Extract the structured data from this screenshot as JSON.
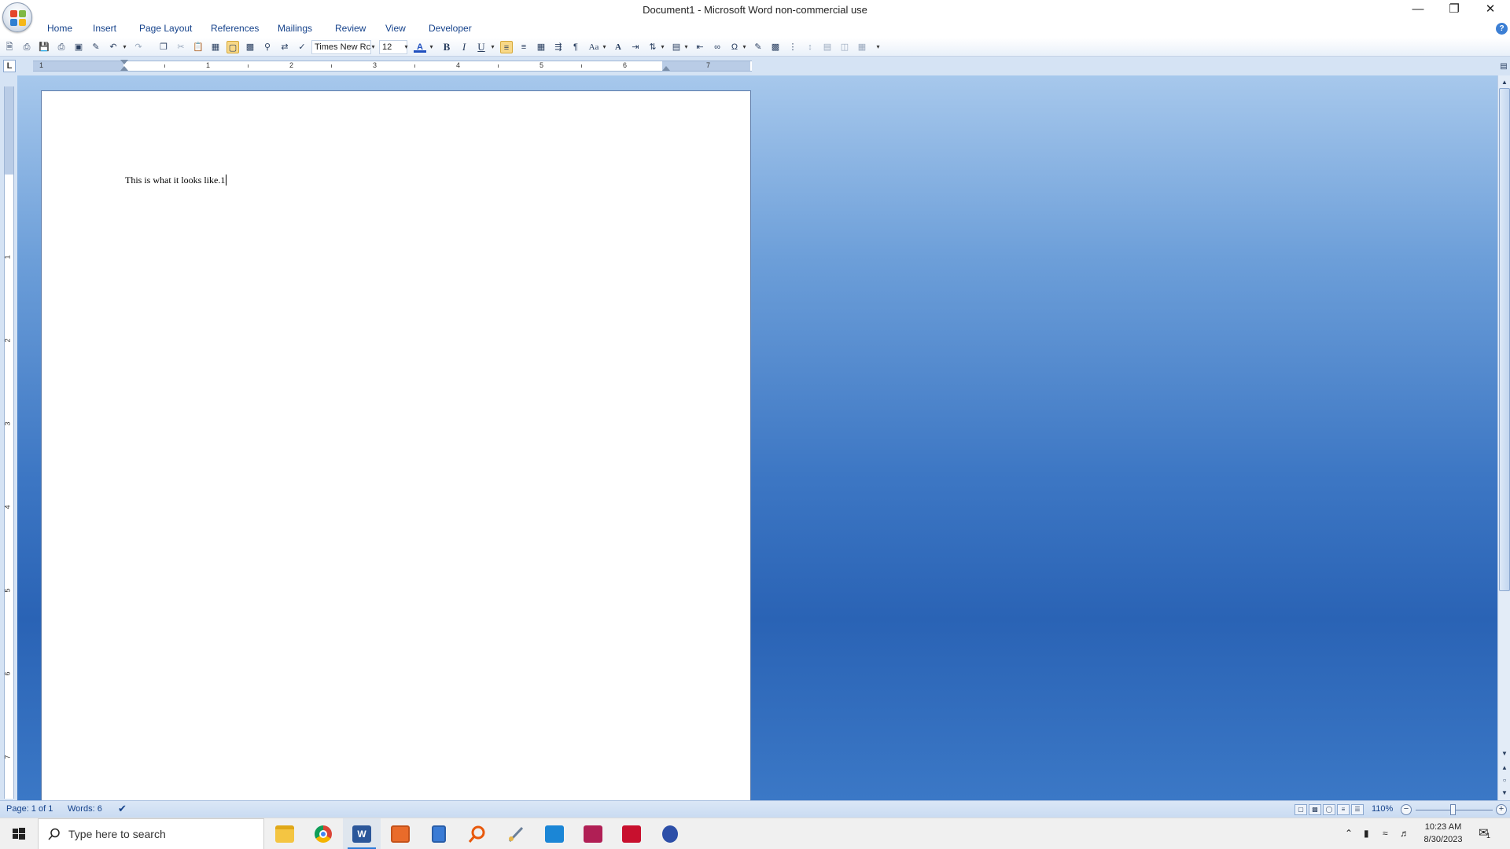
{
  "window": {
    "title": "Document1 - Microsoft Word non-commercial use"
  },
  "ribbon": {
    "tabs": [
      {
        "label": "Home"
      },
      {
        "label": "Insert"
      },
      {
        "label": "Page Layout"
      },
      {
        "label": "References"
      },
      {
        "label": "Mailings"
      },
      {
        "label": "Review"
      },
      {
        "label": "View"
      },
      {
        "label": "Developer"
      }
    ]
  },
  "toolbar": {
    "font_name": "Times New Rc",
    "font_size": "12",
    "bold_label": "B",
    "italic_label": "I",
    "underline_label": "U",
    "change_case_label": "Aa",
    "font_color_label": "A"
  },
  "ruler": {
    "tab_selector": "L",
    "numbers": [
      "1",
      "1",
      "2",
      "3",
      "4",
      "5",
      "6",
      "7"
    ],
    "vertical_numbers": [
      "1",
      "2",
      "3",
      "4",
      "5",
      "6",
      "7"
    ]
  },
  "document": {
    "text": "This is what it looks like.1"
  },
  "statusbar": {
    "page": "Page: 1 of 1",
    "words": "Words: 6",
    "zoom": "110%",
    "zoom_level_percent": 110
  },
  "taskbar": {
    "search_placeholder": "Type here to search",
    "time": "10:23 AM",
    "date": "8/30/2023",
    "notification_count": "1"
  },
  "colors": {
    "tab_text": "#15428b",
    "document_background": "#2a63b5",
    "accent": "#2b7bd8"
  }
}
